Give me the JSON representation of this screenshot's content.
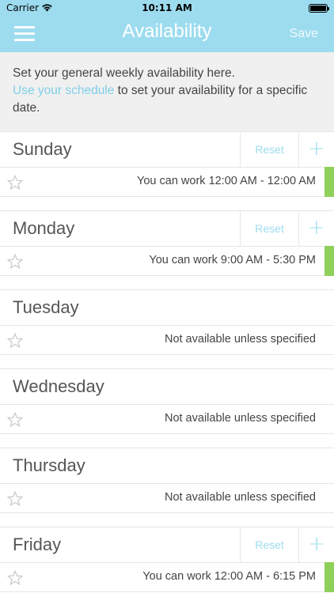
{
  "status_bar": {
    "carrier": "Carrier",
    "time": "10:11 AM"
  },
  "header": {
    "title": "Availability",
    "save_label": "Save",
    "bg_color": "#9ddcef"
  },
  "intro": {
    "text_before": "Set your general weekly availability here.",
    "link_text": "Use your schedule",
    "text_after": " to set your availability for a specific date.",
    "link_color": "#7fcfe8"
  },
  "days": [
    {
      "name": "Sunday",
      "has_actions": true,
      "reset_label": "Reset",
      "add_label": "+",
      "status": "You can work 12:00 AM - 12:00 AM",
      "available": true
    },
    {
      "name": "Monday",
      "has_actions": true,
      "reset_label": "Reset",
      "add_label": "+",
      "status": "You can work 9:00 AM - 5:30 PM",
      "available": true
    },
    {
      "name": "Tuesday",
      "has_actions": false,
      "status": "Not available unless specified",
      "available": false
    },
    {
      "name": "Wednesday",
      "has_actions": false,
      "status": "Not available unless specified",
      "available": false
    },
    {
      "name": "Thursday",
      "has_actions": false,
      "status": "Not available unless specified",
      "available": false
    },
    {
      "name": "Friday",
      "has_actions": true,
      "reset_label": "Reset",
      "add_label": "+",
      "status": "You can work 12:00 AM - 6:15 PM",
      "available": true
    }
  ],
  "colors": {
    "available_bar": "#8fd05a",
    "accent": "#9ddcef"
  }
}
